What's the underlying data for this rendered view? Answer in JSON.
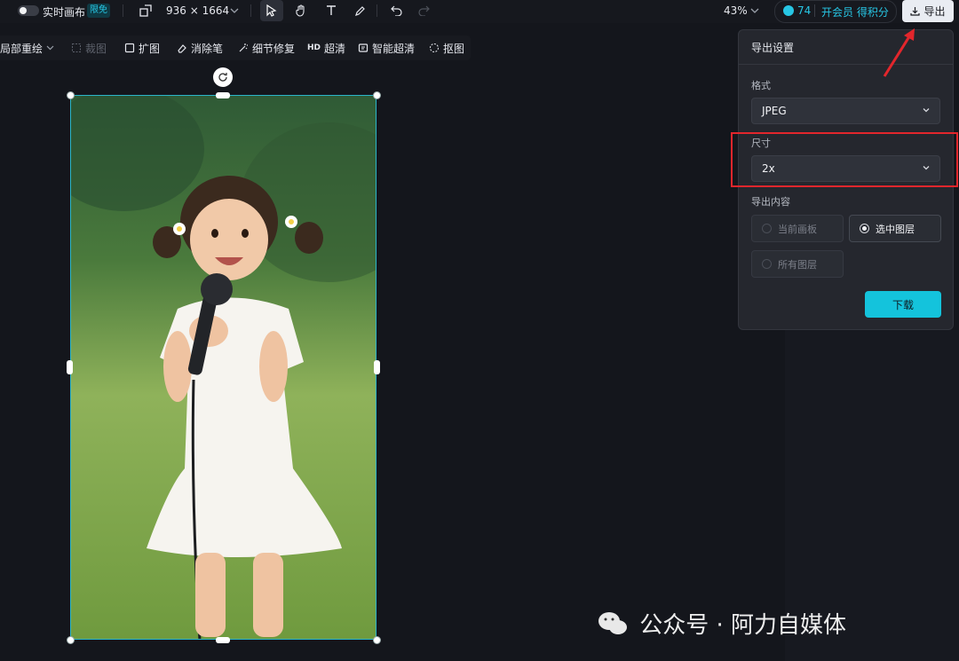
{
  "topbar": {
    "live_canvas_label": "实时画布",
    "limited_badge": "限免",
    "canvas_size": "936 × 1664",
    "zoom": "43%",
    "credits_count": "74",
    "member_text": "开会员 得积分",
    "export_label": "导出"
  },
  "subtoolbar": {
    "items": [
      "局部重绘",
      "裁图",
      "扩图",
      "消除笔",
      "细节修复",
      "超清",
      "智能超清",
      "抠图"
    ],
    "hd_prefix": "HD"
  },
  "export_panel": {
    "title": "导出设置",
    "format_label": "格式",
    "format_value": "JPEG",
    "size_label": "尺寸",
    "size_value": "2x",
    "content_label": "导出内容",
    "content_options": [
      "当前画板",
      "选中图层",
      "所有图层"
    ],
    "selected_option": "选中图层",
    "download_label": "下载"
  },
  "watermark": "公众号 · 阿力自媒体",
  "colors": {
    "accent": "#14c3dc",
    "selection": "#2bb5c9",
    "highlight": "#e3262c",
    "arrow": "#e3262c"
  }
}
